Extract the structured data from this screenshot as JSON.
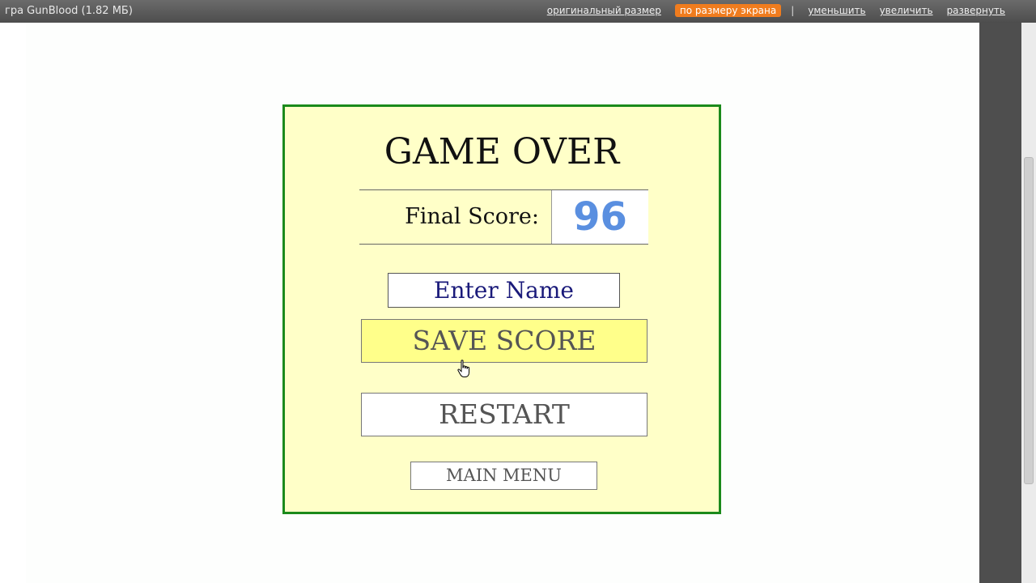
{
  "window": {
    "title": "гра GunBlood (1.82 МБ)"
  },
  "toolbar": {
    "original_size": "оригинальный размер",
    "fit_screen": "по размеру экрана",
    "separator": "|",
    "zoom_out": "уменьшить",
    "zoom_in": "увеличить",
    "expand": "развернуть"
  },
  "game": {
    "title": "GAME OVER",
    "final_score_label": "Final Score:",
    "final_score_value": "96",
    "name_input": "Enter Name",
    "save_score": "SAVE SCORE",
    "restart": "RESTART",
    "main_menu": "MAIN MENU"
  },
  "colors": {
    "panel_bg": "#ffffc8",
    "panel_border": "#1b8a1b",
    "score_color": "#5a8fe0",
    "save_bg": "#ffff8a",
    "toolbar_active": "#f07c1e"
  }
}
